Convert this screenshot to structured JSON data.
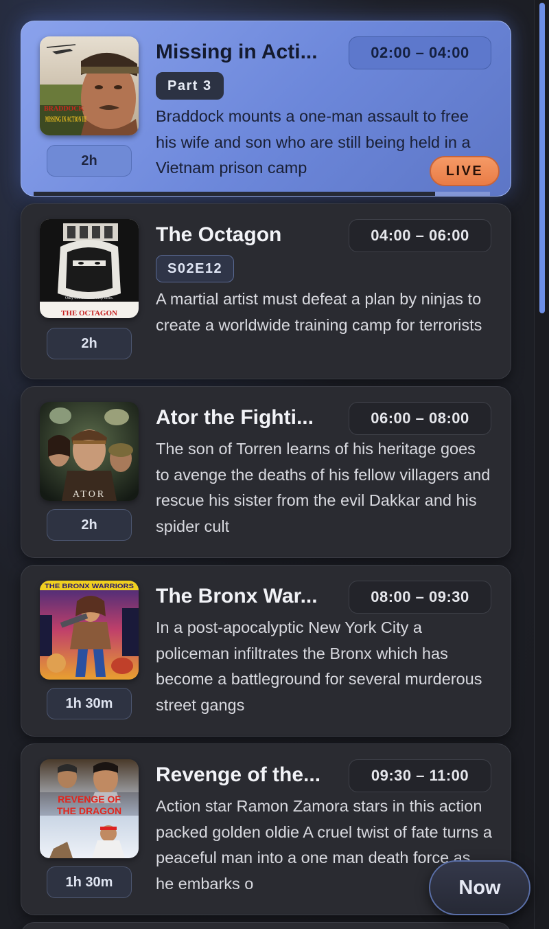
{
  "programs": [
    {
      "title": "Missing in Acti...",
      "time": "02:00 – 04:00",
      "badge": "Part 3",
      "duration": "2h",
      "description": "Braddock mounts a one-man assault to free his wife and son who are still being held in a Vietnam prison camp",
      "live_label": "LIVE",
      "progress": 0.88
    },
    {
      "title": "The Octagon",
      "time": "04:00 – 06:00",
      "badge": "S02E12",
      "duration": "2h",
      "description": "A martial artist must defeat a plan by ninjas to create a worldwide training camp for terrorists"
    },
    {
      "title": "Ator the Fighti...",
      "time": "06:00 – 08:00",
      "duration": "2h",
      "description": "The son of Torren learns of his heritage goes to avenge the deaths of his fellow villagers and rescue his sister from the evil Dakkar and his spider cult"
    },
    {
      "title": "The Bronx War...",
      "time": "08:00 – 09:30",
      "duration": "1h 30m",
      "description": "In a post-apocalyptic New York City a policeman infiltrates the Bronx which has become a battleground for several murderous street gangs"
    },
    {
      "title": "Revenge of the...",
      "time": "09:30 – 11:00",
      "duration": "1h 30m",
      "description": "Action star Ramon Zamora stars in this action packed golden oldie A cruel twist of fate turns a peaceful man into a one man death force as he embarks o"
    }
  ],
  "poster_text": {
    "octagon_tagline": "Only one man can stop them.",
    "octagon_title": "THE OCTAGON",
    "revenge_line1": "REVENGE OF",
    "revenge_line2": "THE DRAGON",
    "ator": "ATOR",
    "missing": "MISSING IN ACTION III",
    "bronx": "THE BRONX WARRIORS"
  },
  "now_button": "Now",
  "colors": {
    "live_card": "#7890e0",
    "live_badge": "#ef8a55",
    "accent": "#6e8fe6"
  }
}
